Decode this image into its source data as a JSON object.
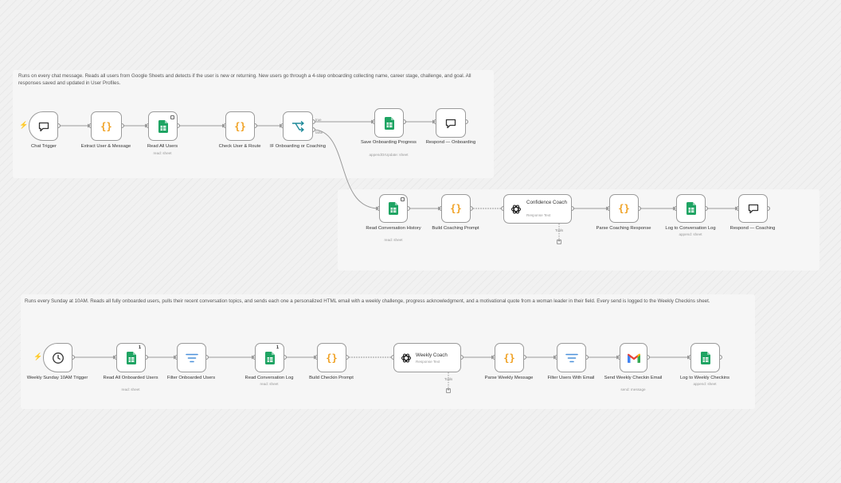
{
  "notes": {
    "chat_flow": "Runs on every chat message. Reads all users from Google Sheets and detects if the user is new or returning. New users go through a 4-step onboarding collecting name, career stage, challenge, and goal. All responses saved and updated in User Profiles.",
    "weekly_flow": "Runs every Sunday at 10AM. Reads all fully onboarded users, pulls their recent conversation topics, and sends each one a personalized HTML email with a weekly challenge, progress acknowledgment, and a motivational quote from a woman leader in their field. Every send is logged to the Weekly Checkins sheet."
  },
  "nodes": {
    "chat_trigger": "Chat Trigger",
    "extract_user": "Extract User & Message",
    "read_all_users": "Read All Users",
    "read_all_users_sub": "read: sheet",
    "check_user": "Check User & Route",
    "if_onboarding": "IF Onboarding or Coaching",
    "save_onboarding": "Save Onboarding Progress",
    "save_onboarding_sub": "appendOrUpdate: sheet",
    "respond_onboarding": "Respond — Onboarding",
    "read_conv_history": "Read Conversation History",
    "read_conv_history_sub": "read: sheet",
    "build_coaching": "Build Coaching Prompt",
    "confidence_coach": "Confidence Coach",
    "confidence_coach_sub": "Response Text",
    "parse_coaching": "Parse Coaching Response",
    "log_conversation": "Log to Conversation Log",
    "log_conversation_sub": "append: sheet",
    "respond_coaching": "Respond — Coaching",
    "weekly_trigger": "Weekly Sunday 10AM Trigger",
    "read_onboarded": "Read All Onboarded Users",
    "read_onboarded_sub": "read: sheet",
    "filter_onboarded": "Filter Onboarded Users",
    "read_conv_log": "Read Conversation Log",
    "read_conv_log_sub": "read: sheet",
    "build_checkin": "Build Checkin Prompt",
    "weekly_coach": "Weekly Coach",
    "weekly_coach_sub": "Response Text",
    "parse_weekly": "Parse Weekly Message",
    "filter_email": "Filter Users With Email",
    "send_email": "Send Weekly Checkin Email",
    "send_email_sub": "send: message",
    "log_weekly": "Log to Weekly Checkins",
    "log_weekly_sub": "append: sheet"
  },
  "branches": {
    "true": "true",
    "false": "false"
  },
  "tool_ports": {
    "tools": "Tools"
  },
  "badges": {
    "read_onboarded": "1",
    "read_conv_log": "1"
  },
  "icons": {
    "chat": "chat-bubble-icon",
    "code": "code-braces-icon",
    "sheets": "google-sheets-icon",
    "if": "if-branch-icon",
    "ai": "openai-icon",
    "filter": "filter-icon",
    "gmail": "gmail-icon",
    "clock": "clock-icon",
    "trigger": "bolt-icon"
  },
  "colors": {
    "sheets_green": "#1fa463",
    "code_orange": "#f0a020",
    "filter_blue": "#4a90d9",
    "trigger_orange": "#f07b2e",
    "wire": "#9a9a9a"
  }
}
